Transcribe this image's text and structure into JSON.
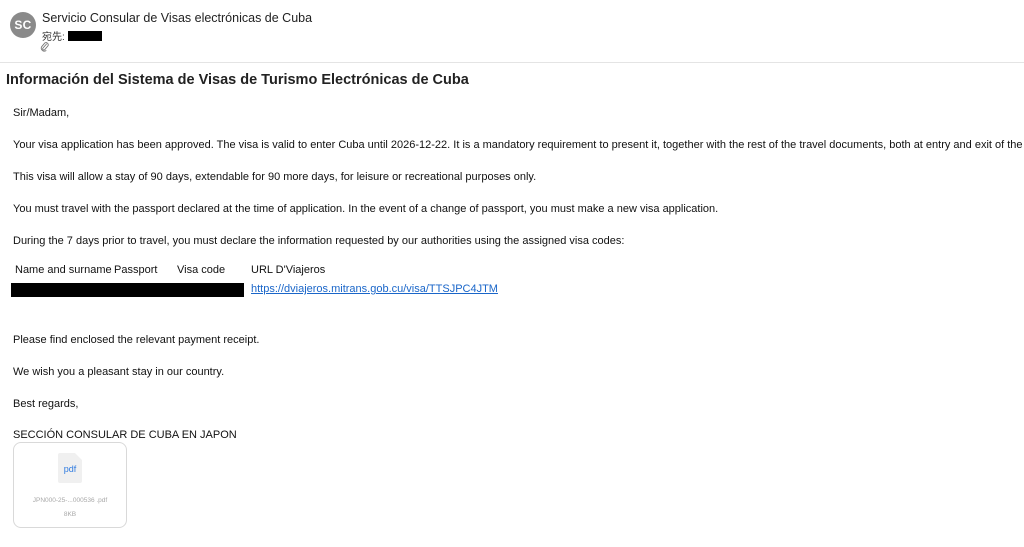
{
  "header": {
    "avatar_initials": "SC",
    "sender": "Servicio Consular de Visas electrónicas de Cuba",
    "to_label": "宛先:",
    "attach_icon": "paperclip-icon"
  },
  "subject": "Información del Sistema de Visas de Turismo Electrónicas de Cuba",
  "body": {
    "greeting": "Sir/Madam,",
    "p1": "Your visa application has been approved. The visa is valid to enter Cuba until 2026-12-22. It is a mandatory requirement to present it, together with the rest of the travel documents, both at entry and exit of the country.",
    "p2": "This visa will allow a stay of 90 days, extendable for 90 more days, for leisure or recreational purposes only.",
    "p3": "You must travel with the passport declared at the time of application. In the event of a change of passport, you must make a new visa application.",
    "p4": "During the 7 days prior to travel, you must declare the information requested by our authorities using the assigned visa codes:",
    "p5": "Please find enclosed the relevant payment receipt.",
    "p6": "We wish you a pleasant stay in our country.",
    "p7": "Best regards,",
    "signature": "SECCIÓN CONSULAR DE CUBA EN JAPON"
  },
  "visa_table": {
    "headers": [
      "Name and surname",
      "Passport",
      "Visa code",
      "URL D'Viajeros"
    ],
    "link": "https://dviajeros.mitrans.gob.cu/visa/TTSJPC4JTM"
  },
  "attachment": {
    "type_label": "pdf",
    "filename": "JPN000-25-...000536 .pdf",
    "size": "8KB"
  }
}
